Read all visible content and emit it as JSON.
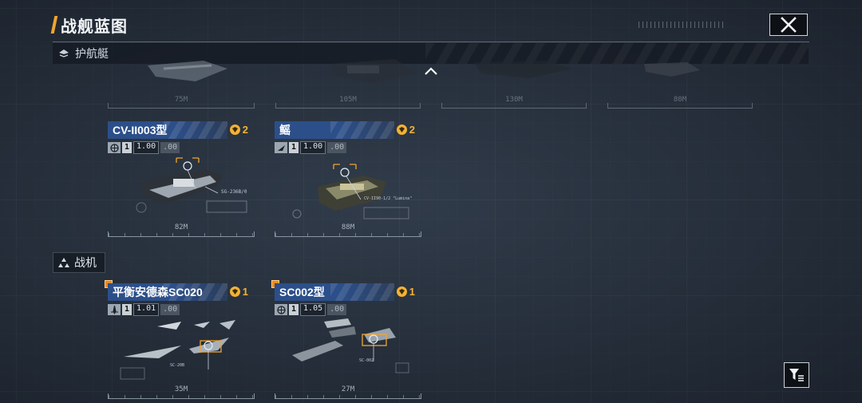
{
  "header": {
    "title": "战舰蓝图"
  },
  "sections": {
    "escort": {
      "label": "护航艇"
    },
    "fighter": {
      "label": "战机"
    }
  },
  "faded_row": [
    {
      "length": "75M"
    },
    {
      "length": "105M"
    },
    {
      "length": "130M"
    },
    {
      "length": "80M"
    }
  ],
  "cards": [
    {
      "name": "CV-II003型",
      "count": "2",
      "level": "1",
      "value": "1.00",
      "decimals": ".00",
      "length": "82M",
      "tag": "SG-236B/0"
    },
    {
      "name": "鳐",
      "count": "2",
      "level": "1",
      "value": "1.00",
      "decimals": ".00",
      "length": "88M",
      "tag": "CV-II90-1/2 \"Lumina\""
    },
    {
      "name": "平衡安德森SC020",
      "count": "1",
      "level": "1",
      "value": "1.01",
      "decimals": ".00",
      "length": "35M",
      "tag": "SC-20B"
    },
    {
      "name": "SC002型",
      "count": "1",
      "level": "1",
      "value": "1.05",
      "decimals": ".00",
      "length": "27M",
      "tag": "SC-002"
    }
  ],
  "icons": {
    "close": "close-icon",
    "expand": "chevron-up-icon",
    "filter": "filter-icon",
    "coin": "blueprint-coin-icon"
  },
  "colors": {
    "accent": "#f0a530",
    "name_bar": "#2c4f8a",
    "coin": "#f2b233"
  }
}
